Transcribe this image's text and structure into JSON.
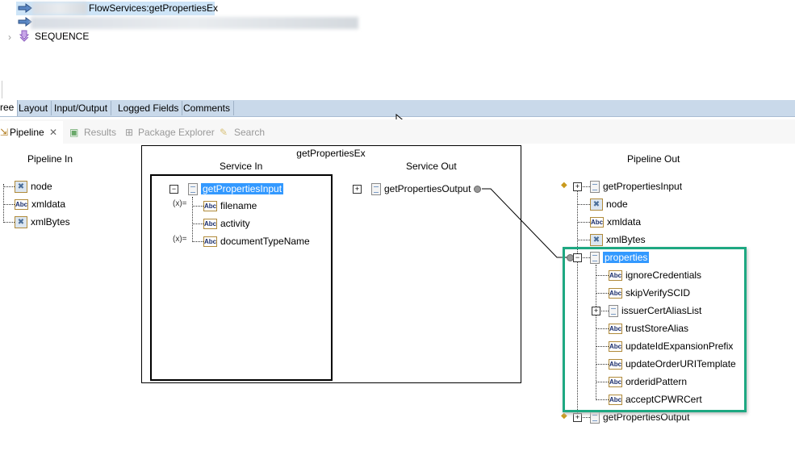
{
  "top_tree": {
    "items": [
      {
        "label": "FlowServices:getPropertiesEx",
        "icon": "invoke-arrow-icon"
      },
      {
        "label": "",
        "icon": "invoke-arrow-icon"
      },
      {
        "label": "SEQUENCE",
        "icon": "sequence-icon"
      }
    ]
  },
  "editor_tabs": [
    "ree",
    "Layout",
    "Input/Output",
    "Logged Fields",
    "Comments"
  ],
  "view_tabs": {
    "pipeline": "Pipeline",
    "results": "Results",
    "package_explorer": "Package Explorer",
    "search": "Search"
  },
  "pipeline_in": {
    "title": "Pipeline In",
    "items": [
      {
        "label": "node",
        "icon": "node"
      },
      {
        "label": "xmldata",
        "icon": "abc"
      },
      {
        "label": "xmlBytes",
        "icon": "node"
      }
    ]
  },
  "service": {
    "title": "getPropertiesEx",
    "service_in_title": "Service In",
    "service_out_title": "Service Out",
    "service_in": {
      "root": "getPropertiesInput",
      "children": [
        "filename",
        "activity",
        "documentTypeName"
      ]
    },
    "service_out": {
      "root": "getPropertiesOutput"
    }
  },
  "pipeline_out": {
    "title": "Pipeline Out",
    "items": [
      {
        "label": "getPropertiesInput",
        "icon": "doc",
        "level": 0,
        "pm": "+"
      },
      {
        "label": "node",
        "icon": "node",
        "level": 1
      },
      {
        "label": "xmldata",
        "icon": "abc",
        "level": 1
      },
      {
        "label": "xmlBytes",
        "icon": "node",
        "level": 1
      },
      {
        "label": "properties",
        "icon": "doc",
        "level": 0,
        "pm": "-",
        "selected": true
      },
      {
        "label": "ignoreCredentials",
        "icon": "abc",
        "level": 2
      },
      {
        "label": "skipVerifySCID",
        "icon": "abc",
        "level": 2
      },
      {
        "label": "issuerCertAliasList",
        "icon": "doc",
        "level": 2,
        "pm": "+"
      },
      {
        "label": "trustStoreAlias",
        "icon": "abc",
        "level": 2
      },
      {
        "label": "updateIdExpansionPrefix",
        "icon": "abc",
        "level": 2
      },
      {
        "label": "updateOrderURITemplate",
        "icon": "abc",
        "level": 2
      },
      {
        "label": "orderidPattern",
        "icon": "abc",
        "level": 2
      },
      {
        "label": "acceptCPWRCert",
        "icon": "abc",
        "level": 2
      },
      {
        "label": "getPropertiesOutput",
        "icon": "doc",
        "level": 0,
        "pm": "+"
      }
    ]
  },
  "colors": {
    "highlight_box": "#1ea882",
    "selection": "#3399ff",
    "tab_strip": "#c9d9ea"
  }
}
